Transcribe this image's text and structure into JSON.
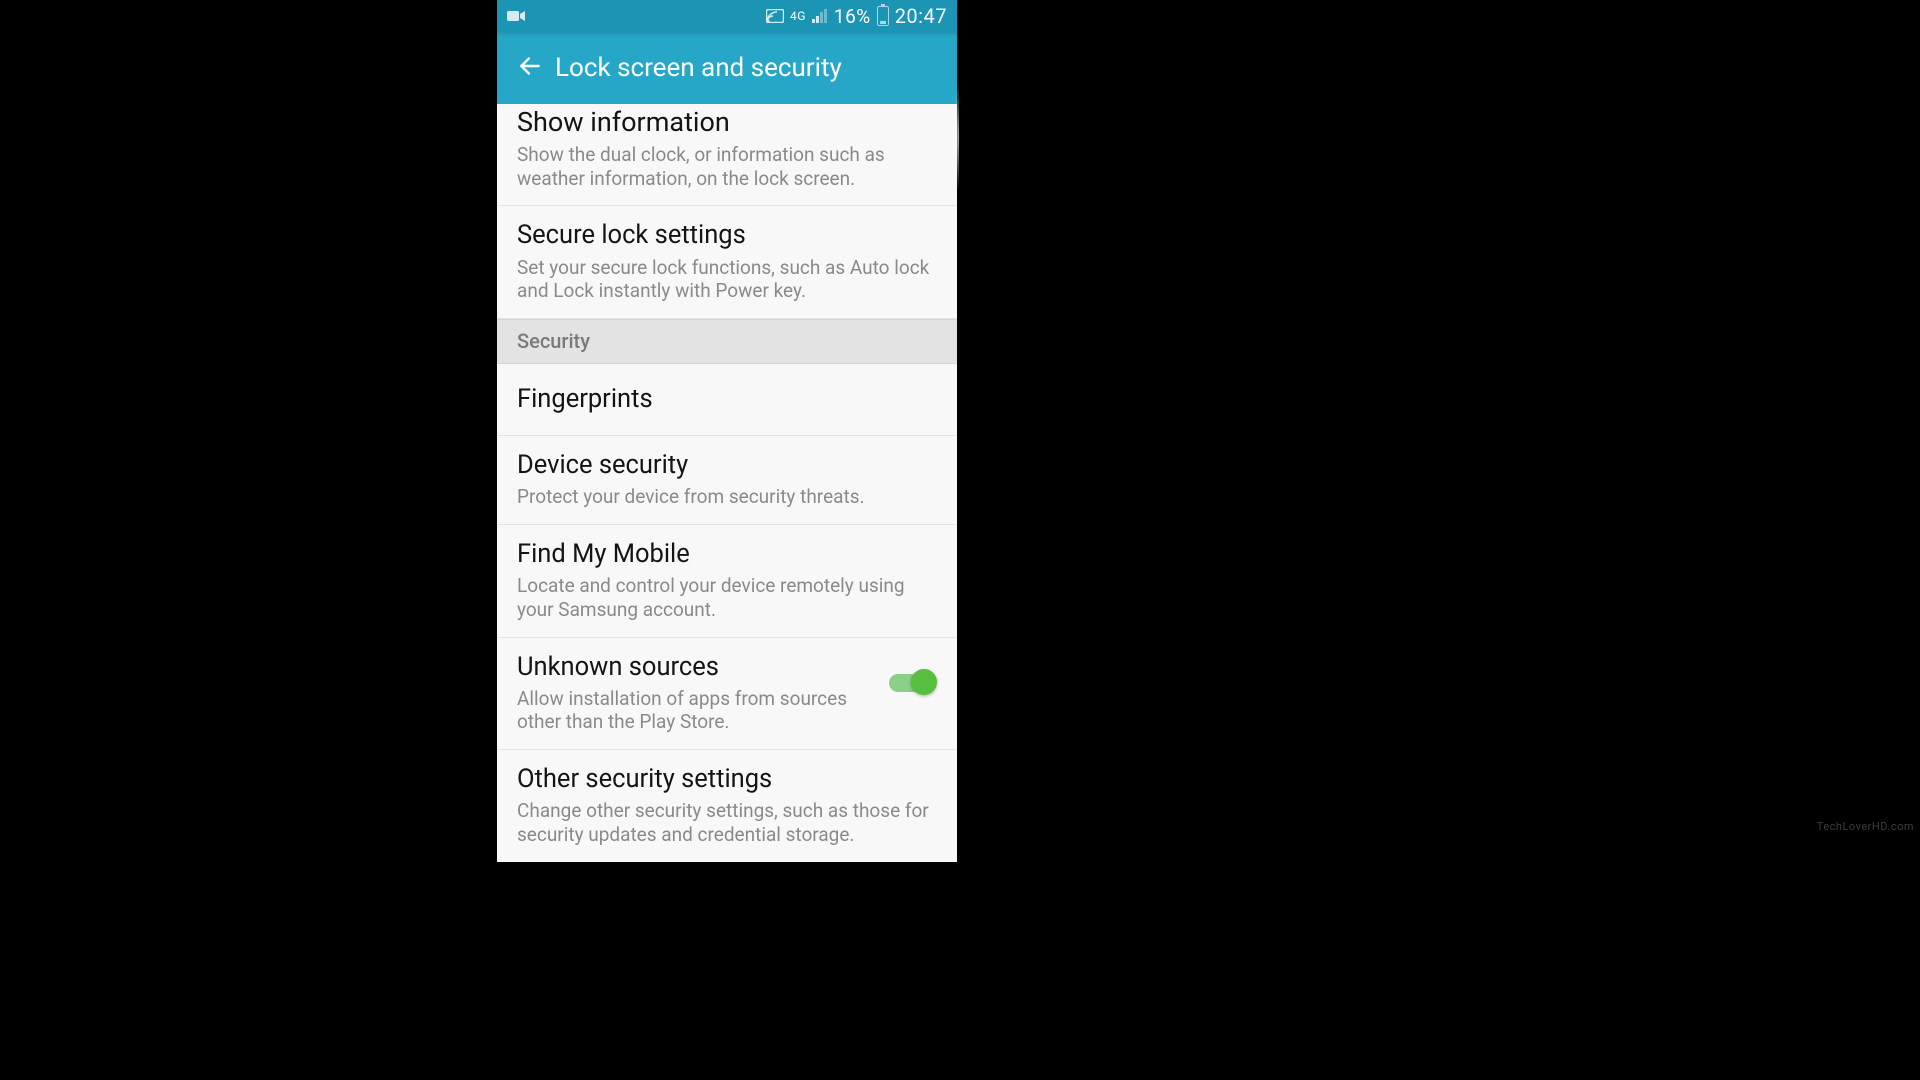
{
  "status_bar": {
    "network_type": "4G",
    "battery_percent": "16%",
    "time": "20:47"
  },
  "app_bar": {
    "title": "Lock screen and security"
  },
  "rows": {
    "show_info": {
      "title": "Show information",
      "desc": "Show the dual clock, or information such as weather information, on the lock screen."
    },
    "secure_lock": {
      "title": "Secure lock settings",
      "desc": "Set your secure lock functions, such as Auto lock and Lock instantly with Power key."
    },
    "section_security": "Security",
    "fingerprints": {
      "title": "Fingerprints"
    },
    "device_security": {
      "title": "Device security",
      "desc": "Protect your device from security threats."
    },
    "find_my_mobile": {
      "title": "Find My Mobile",
      "desc": "Locate and control your device remotely using your Samsung account."
    },
    "unknown_sources": {
      "title": "Unknown sources",
      "desc": "Allow installation of apps from sources other than the Play Store.",
      "toggle_on": true
    },
    "other_security": {
      "title": "Other security settings",
      "desc": "Change other security settings, such as those for security updates and credential storage."
    }
  },
  "watermark": "TechLoverHD.com"
}
